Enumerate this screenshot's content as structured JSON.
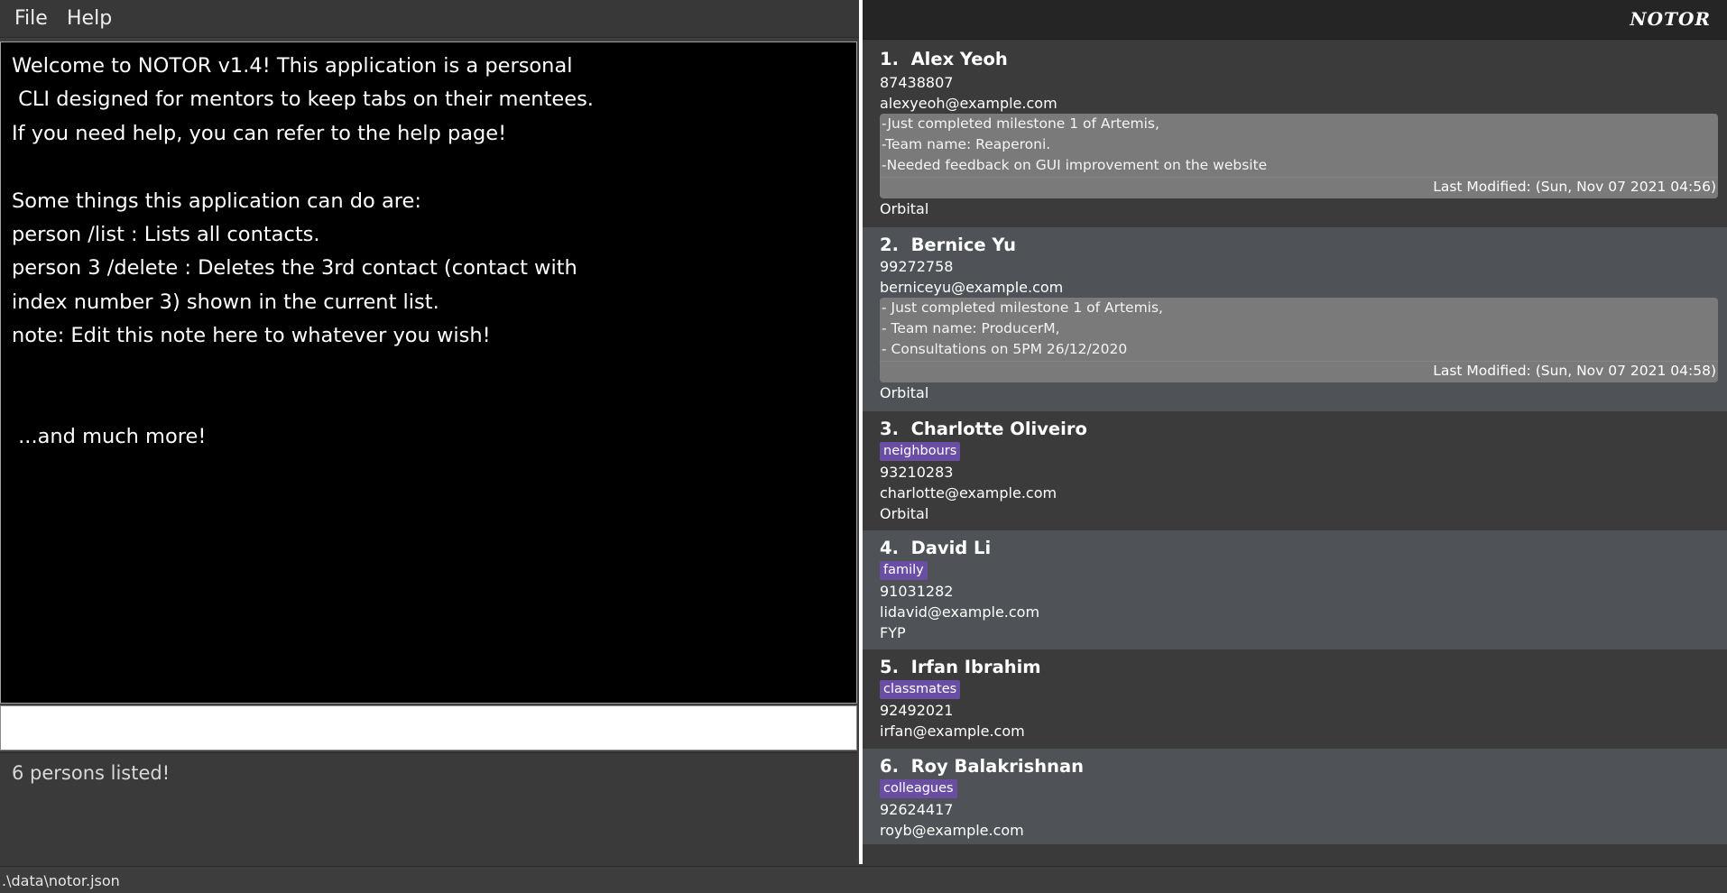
{
  "menu": {
    "file": "File",
    "help": "Help"
  },
  "brand": "NOTOR",
  "note_panel": {
    "text": "Welcome to NOTOR v1.4! This application is a personal\n CLI designed for mentors to keep tabs on their mentees.\nIf you need help, you can refer to the help page!\n\nSome things this application can do are:\nperson /list : Lists all contacts.\nperson 3 /delete : Deletes the 3rd contact (contact with\nindex number 3) shown in the current list.\nnote: Edit this note here to whatever you wish!\n\n\n ...and much more!"
  },
  "command_box": {
    "value": ""
  },
  "result": "6 persons listed!",
  "persons": [
    {
      "index": "1.",
      "name": "Alex Yeoh",
      "tags": [],
      "phone": "87438807",
      "email": "alexyeoh@example.com",
      "note_lines": [
        "-Just completed milestone 1 of Artemis,",
        "-Team name: Reaperoni.",
        "-Needed feedback on GUI improvement on the website"
      ],
      "last_modified": "Last Modified: (Sun, Nov 07 2021 04:56)",
      "group": "Orbital"
    },
    {
      "index": "2.",
      "name": "Bernice Yu",
      "tags": [],
      "phone": "99272758",
      "email": "berniceyu@example.com",
      "note_lines": [
        "- Just completed milestone 1 of Artemis,",
        "- Team name: ProducerM,",
        "- Consultations on 5PM 26/12/2020"
      ],
      "last_modified": "Last Modified: (Sun, Nov 07 2021 04:58)",
      "group": "Orbital"
    },
    {
      "index": "3.",
      "name": "Charlotte Oliveiro",
      "tags": [
        "neighbours"
      ],
      "phone": "93210283",
      "email": "charlotte@example.com",
      "group": "Orbital"
    },
    {
      "index": "4.",
      "name": "David Li",
      "tags": [
        "family"
      ],
      "phone": "91031282",
      "email": "lidavid@example.com",
      "group": "FYP"
    },
    {
      "index": "5.",
      "name": "Irfan Ibrahim",
      "tags": [
        "classmates"
      ],
      "phone": "92492021",
      "email": "irfan@example.com",
      "group": ""
    },
    {
      "index": "6.",
      "name": "Roy Balakrishnan",
      "tags": [
        "colleagues"
      ],
      "phone": "92624417",
      "email": "royb@example.com",
      "group": ""
    }
  ],
  "status_bar": {
    "path": ".\\data\\notor.json"
  }
}
